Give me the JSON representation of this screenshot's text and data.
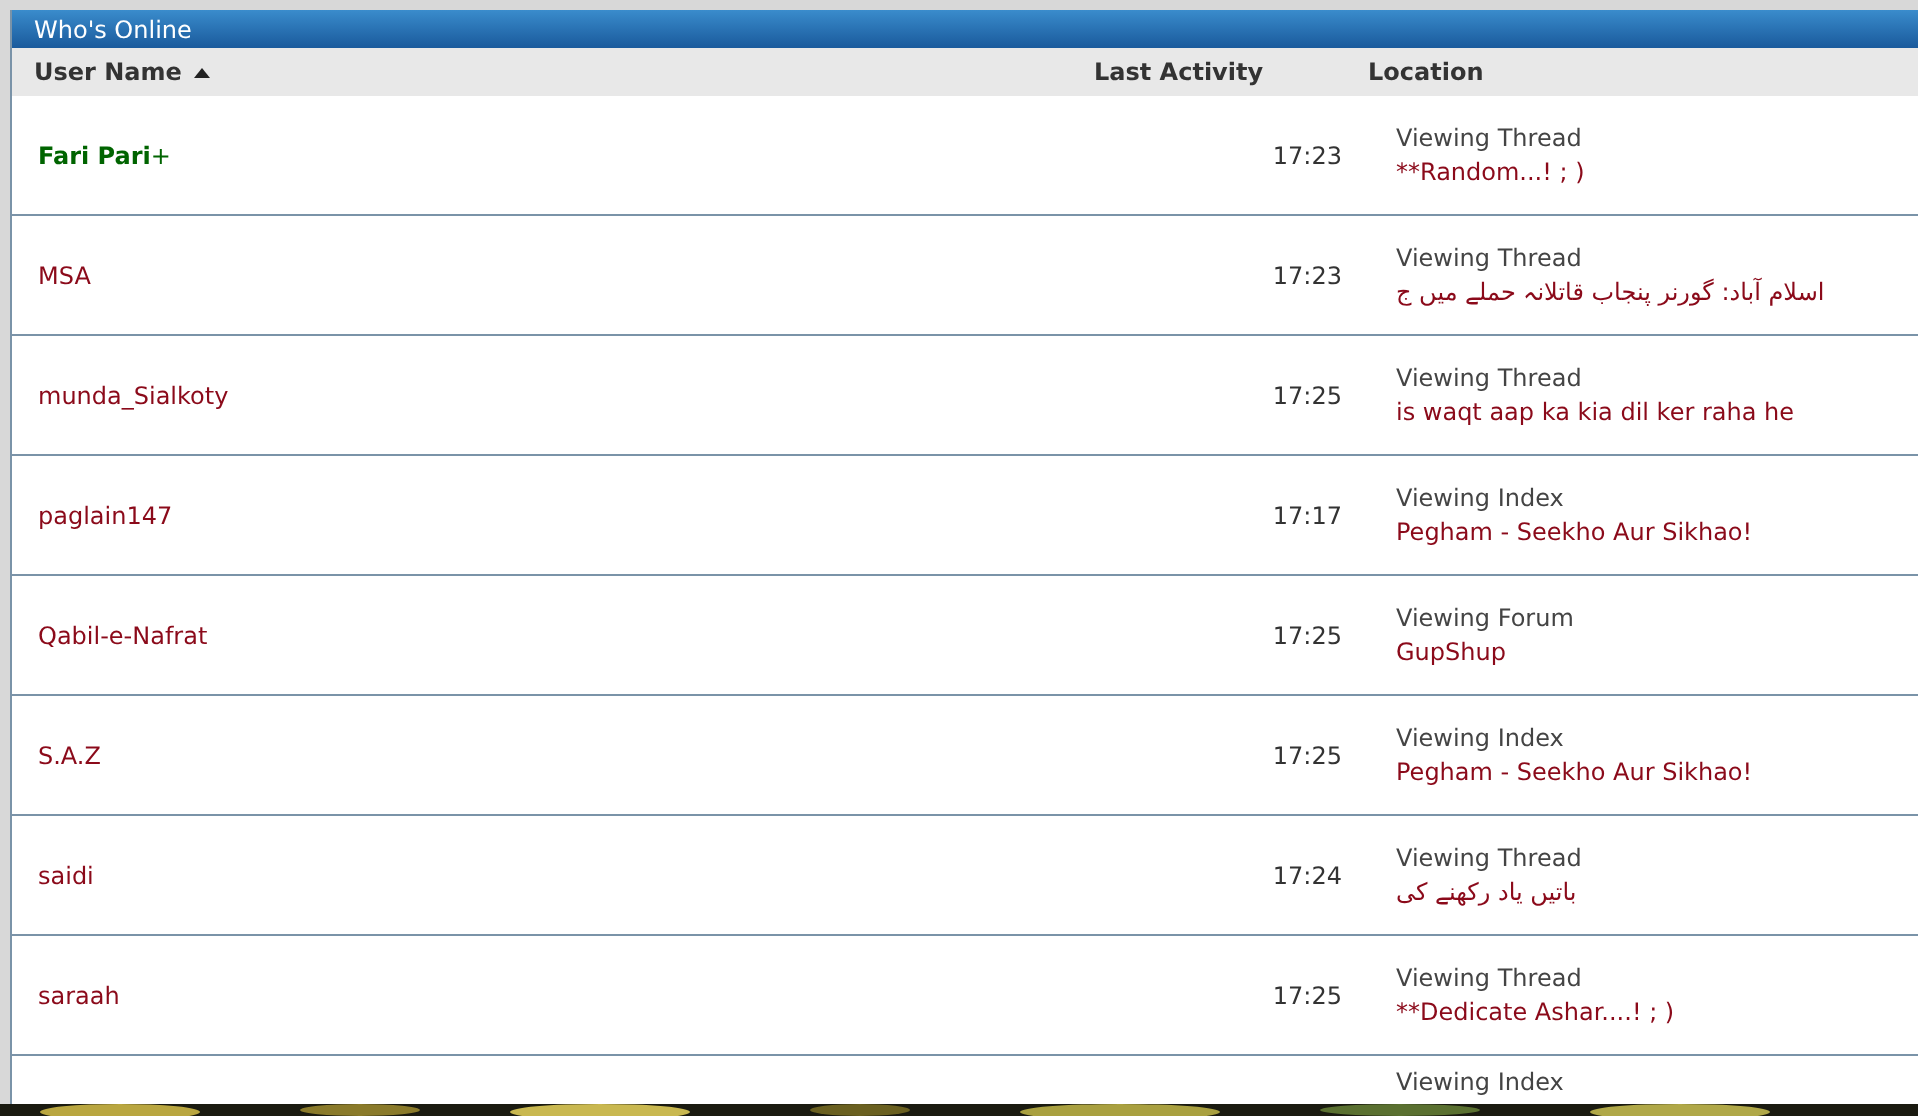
{
  "panel": {
    "title": "Who's Online"
  },
  "columns": [
    {
      "label": "User Name",
      "sorted": true
    },
    {
      "label": "Last Activity",
      "sorted": false
    },
    {
      "label": "Location",
      "sorted": false
    }
  ],
  "rows": [
    {
      "user": "Fari Pari",
      "kind": "staff",
      "suffix": "+",
      "time": "17:23",
      "activity": "Viewing Thread",
      "target": "**Random...! ; )"
    },
    {
      "user": "MSA",
      "kind": "member",
      "time": "17:23",
      "activity": "Viewing Thread",
      "target": "اسلام آباد: گورنر پنجاب قاتلانہ حملے میں ج"
    },
    {
      "user": "munda_Sialkoty",
      "kind": "member",
      "time": "17:25",
      "activity": "Viewing Thread",
      "target": "is waqt aap ka kia dil ker raha he"
    },
    {
      "user": "paglain147",
      "kind": "member",
      "time": "17:17",
      "activity": "Viewing Index",
      "target": "Pegham - Seekho Aur Sikhao!"
    },
    {
      "user": "Qabil-e-Nafrat",
      "kind": "member",
      "time": "17:25",
      "activity": "Viewing Forum",
      "target": "GupShup"
    },
    {
      "user": "S.A.Z",
      "kind": "member",
      "time": "17:25",
      "activity": "Viewing Index",
      "target": "Pegham - Seekho Aur Sikhao!"
    },
    {
      "user": "saidi",
      "kind": "member",
      "time": "17:24",
      "activity": "Viewing Thread",
      "target": "باتیں یاد رکھنے کی"
    },
    {
      "user": "saraah",
      "kind": "member",
      "time": "17:25",
      "activity": "Viewing Thread",
      "target": "**Dedicate Ashar....! ; )"
    }
  ],
  "partial_row": {
    "activity": "Viewing Index"
  }
}
